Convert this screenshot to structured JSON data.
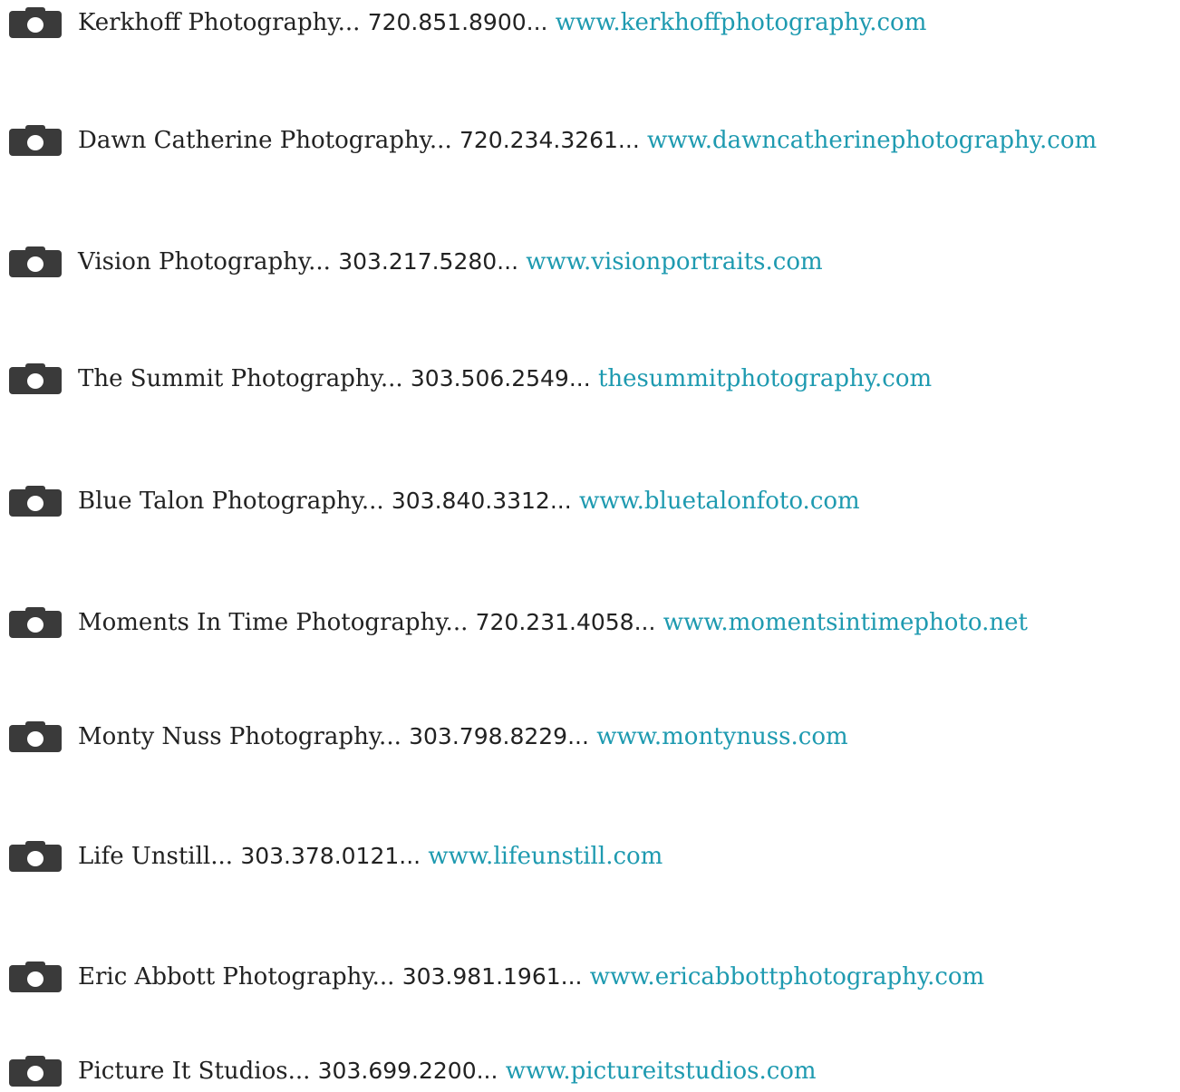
{
  "listings": [
    {
      "name": "Kerkhoff Photography...",
      "phone": "720.851.8900...",
      "url": "www.kerkhoffphotography.com",
      "icon": "camera-icon"
    },
    {
      "name": "Dawn Catherine Photography...",
      "phone": "720.234.3261...",
      "url": "www.dawncatherinephotography.com",
      "icon": "camera-icon"
    },
    {
      "name": "Vision Photography...",
      "phone": "303.217.5280...",
      "url": "www.visionportraits.com",
      "icon": "camera-icon"
    },
    {
      "name": "The Summit Photography...",
      "phone": "303.506.2549...",
      "url": "thesummitphotography.com",
      "icon": "camera-icon"
    },
    {
      "name": "Blue Talon Photography...",
      "phone": "303.840.3312...",
      "url": "www.bluetalonfoto.com",
      "icon": "camera-icon"
    },
    {
      "name": "Moments In Time Photography...",
      "phone": "720.231.4058...",
      "url": "www.momentsintimephoto.net",
      "icon": "camera-icon"
    },
    {
      "name": "Monty Nuss Photography...",
      "phone": "303.798.8229...",
      "url": "www.montynuss.com",
      "icon": "camera-icon"
    },
    {
      "name": "Life Unstill...",
      "phone": "303.378.0121...",
      "url": "www.lifeunstill.com",
      "icon": "camera-icon"
    },
    {
      "name": "Eric Abbott Photography...",
      "phone": "303.981.1961...",
      "url": "www.ericabbottphotography.com",
      "icon": "camera-icon"
    },
    {
      "name": "Picture It Studios...",
      "phone": "303.699.2200...",
      "url": "www.pictureitstudios.com",
      "icon": "camera-icon"
    }
  ],
  "colors": {
    "link": "#1e9ab0",
    "text": "#222222",
    "icon": "#3a3a3a"
  }
}
